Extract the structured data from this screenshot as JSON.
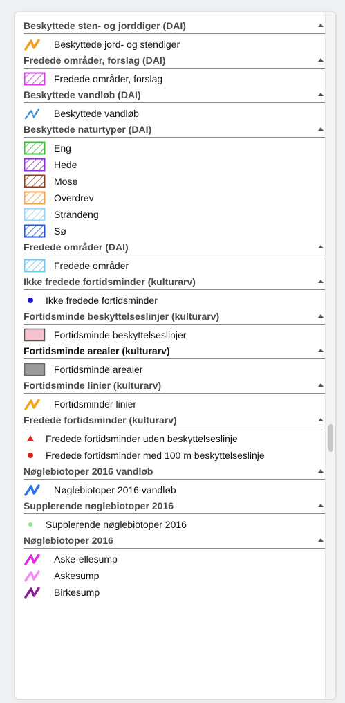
{
  "sections": [
    {
      "title": "Beskyttede sten- og jorddiger (DAI)",
      "items": [
        {
          "label": "Beskyttede jord- og stendiger",
          "icon": "orange-line-icon",
          "color": "#f3a021"
        }
      ]
    },
    {
      "title": "Fredede områder, forslag (DAI)",
      "items": [
        {
          "label": "Fredede områder, forslag",
          "icon": "magenta-hatch-icon",
          "color": "#d23ee3"
        }
      ]
    },
    {
      "title": "Beskyttede vandløb (DAI)",
      "items": [
        {
          "label": "Beskyttede vandløb",
          "icon": "blue-dashed-line-icon",
          "color": "#3d8fd6"
        }
      ]
    },
    {
      "title": "Beskyttede naturtyper (DAI)",
      "items": [
        {
          "label": "Eng",
          "icon": "green-hatch-icon",
          "color": "#3ebd3a"
        },
        {
          "label": "Hede",
          "icon": "purple-hatch-icon",
          "color": "#8e2bd8"
        },
        {
          "label": "Mose",
          "icon": "brown-hatch-icon",
          "color": "#8b3a22"
        },
        {
          "label": "Overdrev",
          "icon": "orange-hatch-icon",
          "color": "#f3a14a"
        },
        {
          "label": "Strandeng",
          "icon": "lightblue-hatch-icon",
          "color": "#8fd7f2"
        },
        {
          "label": "Sø",
          "icon": "blue-hatch-icon",
          "color": "#1f52d8"
        }
      ]
    },
    {
      "title": "Fredede områder (DAI)",
      "items": [
        {
          "label": "Fredede områder",
          "icon": "skyblue-hatch-icon",
          "color": "#6ec7ef"
        }
      ]
    },
    {
      "title": "Ikke fredede fortidsminder (kulturarv)",
      "items": [
        {
          "label": "Ikke fredede fortidsminder",
          "icon": "blue-dot-icon",
          "color": "#1a1adb"
        }
      ]
    },
    {
      "title": "Fortidsminde beskyttelseslinjer (kulturarv)",
      "items": [
        {
          "label": "Fortidsminde beskyttelseslinjer",
          "icon": "pink-box-icon",
          "color": "#f7c2cf"
        }
      ]
    },
    {
      "title": "Fortidsminde arealer (kulturarv)",
      "dark": true,
      "items": [
        {
          "label": "Fortidsminde arealer",
          "icon": "gray-box-icon",
          "color": "#9a9a9a"
        }
      ]
    },
    {
      "title": "Fortidsminde linier (kulturarv)",
      "items": [
        {
          "label": "Fortidsminder linier",
          "icon": "orange-line-icon",
          "color": "#f6a51d"
        }
      ]
    },
    {
      "title": "Fredede fortidsminder (kulturarv)",
      "items": [
        {
          "label": "Fredede fortidsminder uden beskyttelseslinje",
          "icon": "red-triangle-icon",
          "color": "#e02020"
        },
        {
          "label": "Fredede fortidsminder med 100 m beskyttelseslinje",
          "icon": "red-dot-icon",
          "color": "#e02020"
        }
      ]
    },
    {
      "title": "Nøglebiotoper 2016 vandløb",
      "items": [
        {
          "label": "Nøglebiotoper 2016 vandløb",
          "icon": "blue-line-icon",
          "color": "#2f72e8"
        }
      ]
    },
    {
      "title": "Supplerende nøglebiotoper 2016",
      "items": [
        {
          "label": "Supplerende nøglebiotoper 2016",
          "icon": "green-dot-icon",
          "color": "#8fe58f"
        }
      ]
    },
    {
      "title": "Nøglebiotoper 2016",
      "items": [
        {
          "label": "Aske-ellesump",
          "icon": "magenta-line-icon",
          "color": "#df2ee0"
        },
        {
          "label": "Askesump",
          "icon": "pink-line-icon",
          "color": "#f38ff2"
        },
        {
          "label": "Birkesump",
          "icon": "darkpurple-line-icon",
          "color": "#8e1d9a"
        }
      ]
    }
  ]
}
